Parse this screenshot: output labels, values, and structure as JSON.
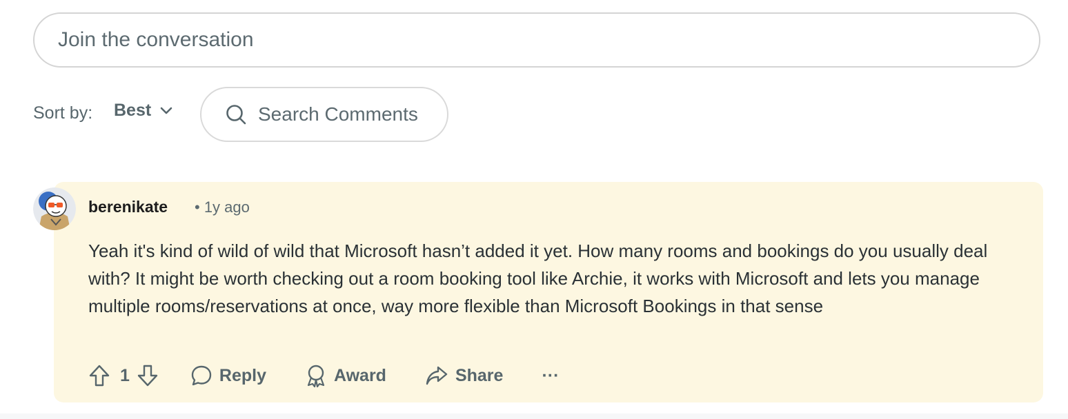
{
  "composer": {
    "placeholder": "Join the conversation"
  },
  "sort": {
    "label": "Sort by:",
    "value": "Best"
  },
  "search": {
    "placeholder": "Search Comments"
  },
  "comment": {
    "author": "berenikate",
    "time": "• 1y ago",
    "body": "Yeah it's kind of wild of wild that Microsoft hasn’t added it yet. How many rooms and bookings do you usually deal with? It might be worth checking out a room booking tool like Archie, it works with Microsoft and lets you manage multiple rooms/reservations at once, way more flexible than Microsoft Bookings in that sense",
    "score": "1",
    "reply_label": "Reply",
    "award_label": "Award",
    "share_label": "Share",
    "more_label": "···"
  },
  "colors": {
    "highlight_bg": "#fdf7e1",
    "muted_text": "#57666c"
  }
}
